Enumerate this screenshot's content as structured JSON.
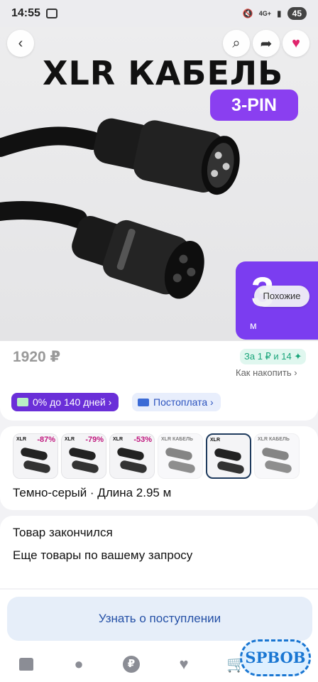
{
  "status_bar": {
    "time": "14:55",
    "network": "4G+",
    "battery": "45"
  },
  "hero": {
    "title": "XLR КАБЕЛЬ",
    "badge": "3-PIN",
    "promo_number": "3",
    "promo_unit": "м",
    "similar_label": "Похожие",
    "promo_color": "#7b3df0"
  },
  "product": {
    "price": "1920 ₽",
    "bonus": "За 1 ₽ и 14 ✦",
    "accumulate_link": "Как накопить ›"
  },
  "chips": {
    "installment": "0% до 140 дней ›",
    "postpay": "Постоплата ›"
  },
  "variants": {
    "thumbs": [
      {
        "discount": "-87%",
        "label": "XLR"
      },
      {
        "discount": "-79%",
        "label": "XLR"
      },
      {
        "discount": "-53%",
        "label": "XLR"
      },
      {
        "discount": "",
        "label": "XLR КАБЕЛЬ"
      },
      {
        "discount": "",
        "label": "XLR"
      },
      {
        "discount": "",
        "label": "XLR КАБЕЛЬ"
      }
    ],
    "selected_label": "Темно-серый · Длина 2.95 м"
  },
  "stock": {
    "status": "Товар закончился",
    "more": "Еще товары по вашему запросу"
  },
  "notify_button": "Узнать о поступлении",
  "nav": {
    "items": [
      "home-icon",
      "apple-icon",
      "ruble-icon",
      "heart-icon",
      "cart-icon"
    ]
  },
  "watermark": "SPBOB"
}
